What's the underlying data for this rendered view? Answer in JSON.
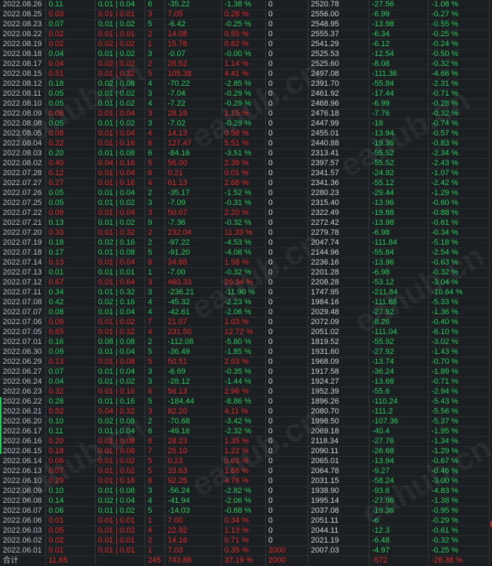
{
  "watermark": "eahub.cn",
  "columns": [
    "date",
    "v1",
    "v2",
    "v3",
    "v4",
    "v5",
    "v6",
    "v7",
    "v8",
    "v9"
  ],
  "rows": [
    [
      "2022.08.26",
      "0.11",
      "0.01 | 0.04",
      "6",
      "-35.22",
      "-1.38 %",
      "0",
      "2520.78",
      "-27.56",
      "-1.08 %"
    ],
    [
      "2022.08.25",
      "0.03",
      "0.01 | 0.01",
      "3",
      "7.05",
      "0.28 %",
      "0",
      "2556.00",
      "-6.99",
      "-0.27 %"
    ],
    [
      "2022.08.23",
      "0.07",
      "0.01 | 0.02",
      "5",
      "-6.42",
      "-0.25 %",
      "0",
      "2548.95",
      "-13.98",
      "-0.55 %"
    ],
    [
      "2022.08.22",
      "0.02",
      "0.01 | 0.01",
      "2",
      "14.08",
      "0.55 %",
      "0",
      "2555.37",
      "-6.34",
      "-0.25 %"
    ],
    [
      "2022.08.19",
      "0.02",
      "0.02 | 0.02",
      "1",
      "15.76",
      "0.62 %",
      "0",
      "2541.29",
      "-6.12",
      "-0.24 %"
    ],
    [
      "2022.08.18",
      "0.04",
      "0.01 | 0.02",
      "3",
      "-0.07",
      "-0.00 %",
      "0",
      "2525.53",
      "-12.54",
      "-0.50 %"
    ],
    [
      "2022.08.17",
      "0.04",
      "0.02 | 0.02",
      "2",
      "28.52",
      "1.14 %",
      "0",
      "2525.60",
      "-8.08",
      "-0.32 %"
    ],
    [
      "2022.08.15",
      "0.51",
      "0.01 | 0.32",
      "5",
      "105.38",
      "4.41 %",
      "0",
      "2497.08",
      "-111.36",
      "-4.66 %"
    ],
    [
      "2022.08.12",
      "0.18",
      "0.02 | 0.08",
      "4",
      "-70.22",
      "-2.85 %",
      "0",
      "2391.70",
      "-55.84",
      "-2.31 %"
    ],
    [
      "2022.08.11",
      "0.05",
      "0.01 | 0.02",
      "3",
      "-7.04",
      "-0.29 %",
      "0",
      "2461.92",
      "-17.44",
      "-0.71 %"
    ],
    [
      "2022.08.10",
      "0.05",
      "0.01 | 0.02",
      "4",
      "-7.22",
      "-0.29 %",
      "0",
      "2468.96",
      "-6.99",
      "-0.28 %"
    ],
    [
      "2022.08.09",
      "0.06",
      "0.01 | 0.04",
      "3",
      "28.19",
      "1.15 %",
      "0",
      "2476.18",
      "-7.76",
      "-0.32 %"
    ],
    [
      "2022.08.08",
      "0.05",
      "0.01 | 0.02",
      "3",
      "-7.02",
      "-0.29 %",
      "0",
      "2447.99",
      "-18",
      "-0.74 %"
    ],
    [
      "2022.08.05",
      "0.08",
      "0.01 | 0.04",
      "4",
      "14.13",
      "0.58 %",
      "0",
      "2455.01",
      "-13.94",
      "-0.57 %"
    ],
    [
      "2022.08.04",
      "0.22",
      "0.01 | 0.16",
      "6",
      "127.47",
      "5.51 %",
      "0",
      "2440.88",
      "-19.36",
      "-0.83 %"
    ],
    [
      "2022.08.03",
      "0.20",
      "0.01 | 0.08",
      "6",
      "-84.16",
      "-3.51 %",
      "0",
      "2313.41",
      "-55.52",
      "-2.34 %"
    ],
    [
      "2022.08.02",
      "0.40",
      "0.04 | 0.16",
      "5",
      "56.00",
      "2.39 %",
      "0",
      "2397.57",
      "-55.52",
      "-2.43 %"
    ],
    [
      "2022.07.28",
      "0.12",
      "0.01 | 0.04",
      "6",
      "0.21",
      "0.01 %",
      "0",
      "2341.57",
      "-24.92",
      "-1.07 %"
    ],
    [
      "2022.07.27",
      "0.27",
      "0.01 | 0.16",
      "4",
      "61.13",
      "2.68 %",
      "0",
      "2341.36",
      "-55.12",
      "-2.42 %"
    ],
    [
      "2022.07.26",
      "0.05",
      "0.01 | 0.04",
      "2",
      "-35.17",
      "-1.52 %",
      "0",
      "2280.23",
      "-29.44",
      "-1.29 %"
    ],
    [
      "2022.07.25",
      "0.05",
      "0.01 | 0.02",
      "3",
      "-7.09",
      "-0.31 %",
      "0",
      "2315.40",
      "-13.96",
      "-0.60 %"
    ],
    [
      "2022.07.22",
      "0.09",
      "0.01 | 0.04",
      "3",
      "50.07",
      "2.20 %",
      "0",
      "2322.49",
      "-19.88",
      "-0.88 %"
    ],
    [
      "2022.07.21",
      "0.13",
      "0.01 | 0.02",
      "9",
      "-7.36",
      "-0.32 %",
      "0",
      "2272.42",
      "-13.98",
      "-0.61 %"
    ],
    [
      "2022.07.20",
      "0.33",
      "0.01 | 0.32",
      "2",
      "232.04",
      "11.33 %",
      "0",
      "2279.78",
      "-6.98",
      "-0.34 %"
    ],
    [
      "2022.07.19",
      "0.18",
      "0.02 | 0.16",
      "2",
      "-97.22",
      "-4.53 %",
      "0",
      "2047.74",
      "-111.84",
      "-5.18 %"
    ],
    [
      "2022.07.18",
      "0.17",
      "0.01 | 0.08",
      "5",
      "-91.20",
      "-4.08 %",
      "0",
      "2144.96",
      "-55.84",
      "-2.54 %"
    ],
    [
      "2022.07.14",
      "0.13",
      "0.01 | 0.04",
      "8",
      "34.88",
      "1.58 %",
      "0",
      "2236.16",
      "-13.96",
      "-0.63 %"
    ],
    [
      "2022.07.13",
      "0.01",
      "0.01 | 0.01",
      "1",
      "-7.00",
      "-0.32 %",
      "0",
      "2201.28",
      "-6.98",
      "-0.32 %"
    ],
    [
      "2022.07.12",
      "0.67",
      "0.01 | 0.64",
      "3",
      "460.33",
      "26.34 %",
      "0",
      "2208.28",
      "-53.12",
      "-3.04 %"
    ],
    [
      "2022.07.11",
      "0.34",
      "0.01 | 0.32",
      "3",
      "-236.21",
      "-11.90 %",
      "0",
      "1747.95",
      "-211.84",
      "-10.64 %"
    ],
    [
      "2022.07.08",
      "0.42",
      "0.02 | 0.16",
      "4",
      "-45.32",
      "-2.23 %",
      "0",
      "1984.16",
      "-111.68",
      "-5.33 %"
    ],
    [
      "2022.07.07",
      "0.08",
      "0.01 | 0.04",
      "4",
      "-42.61",
      "-2.06 %",
      "0",
      "2029.48",
      "-27.92",
      "-1.36 %"
    ],
    [
      "2022.07.06",
      "0.09",
      "0.01 | 0.02",
      "7",
      "21.07",
      "1.03 %",
      "0",
      "2072.09",
      "-8.26",
      "-0.40 %"
    ],
    [
      "2022.07.05",
      "0.65",
      "0.01 | 0.32",
      "4",
      "231.50",
      "12.72 %",
      "0",
      "2051.02",
      "-111.04",
      "-6.10 %"
    ],
    [
      "2022.07.01",
      "0.16",
      "0.08 | 0.08",
      "2",
      "-112.08",
      "-5.80 %",
      "0",
      "1819.52",
      "-55.92",
      "-3.02 %"
    ],
    [
      "2022.06.30",
      "0.09",
      "0.01 | 0.04",
      "5",
      "-36.49",
      "-1.85 %",
      "0",
      "1931.60",
      "-27.92",
      "-1.43 %"
    ],
    [
      "2022.06.29",
      "0.13",
      "0.01 | 0.08",
      "5",
      "50.51",
      "2.63 %",
      "0",
      "1968.09",
      "-13.74",
      "-0.70 %"
    ],
    [
      "2022.06.27",
      "0.07",
      "0.01 | 0.04",
      "3",
      "-6.69",
      "-0.35 %",
      "0",
      "1917.58",
      "-36.24",
      "-1.89 %"
    ],
    [
      "2022.06.24",
      "0.04",
      "0.01 | 0.02",
      "3",
      "-28.12",
      "-1.44 %",
      "0",
      "1924.27",
      "-13.68",
      "-0.71 %"
    ],
    [
      "2022.06.23",
      "0.32",
      "0.01 | 0.16",
      "6",
      "56.13",
      "2.96 %",
      "0",
      "1952.39",
      "-55.6",
      "-2.94 %"
    ],
    [
      "2022.06.22",
      "0.28",
      "0.01 | 0.16",
      "5",
      "-184.44",
      "-8.86 %",
      "0",
      "1896.26",
      "-110.24",
      "-5.43 %"
    ],
    [
      "2022.06.21",
      "0.52",
      "0.04 | 0.32",
      "3",
      "82.20",
      "4.11 %",
      "0",
      "2080.70",
      "-111.2",
      "-5.56 %"
    ],
    [
      "2022.06.20",
      "0.10",
      "0.02 | 0.08",
      "2",
      "-70.68",
      "-3.42 %",
      "0",
      "1998.50",
      "-107.36",
      "-5.37 %"
    ],
    [
      "2022.06.17",
      "0.11",
      "0.01 | 0.04",
      "6",
      "-49.16",
      "-2.32 %",
      "0",
      "2069.18",
      "-40.4",
      "-1.95 %"
    ],
    [
      "2022.06.16",
      "0.20",
      "0.01 | 0.08",
      "8",
      "28.23",
      "1.35 %",
      "0",
      "2118.34",
      "-27.76",
      "-1.34 %"
    ],
    [
      "2022.06.15",
      "0.18",
      "0.01 | 0.08",
      "7",
      "25.10",
      "1.22 %",
      "0",
      "2090.11",
      "-26.68",
      "-1.29 %"
    ],
    [
      "2022.06.14",
      "0.06",
      "0.01 | 0.02",
      "5",
      "0.23",
      "0.01 %",
      "0",
      "2065.01",
      "-13.94",
      "-0.67 %"
    ],
    [
      "2022.06.13",
      "0.07",
      "0.01 | 0.02",
      "5",
      "33.63",
      "1.66 %",
      "0",
      "2064.78",
      "-9.27",
      "-0.46 %"
    ],
    [
      "2022.06.10",
      "0.29",
      "0.01 | 0.16",
      "8",
      "92.25",
      "4.76 %",
      "0",
      "2031.15",
      "-58.24",
      "-3.00 %"
    ],
    [
      "2022.06.09",
      "0.10",
      "0.01 | 0.08",
      "3",
      "-56.24",
      "-2.82 %",
      "0",
      "1938.90",
      "-93.6",
      "-4.83 %"
    ],
    [
      "2022.06.08",
      "0.14",
      "0.02 | 0.04",
      "4",
      "-41.94",
      "-2.06 %",
      "0",
      "1995.14",
      "-27.96",
      "-1.38 %"
    ],
    [
      "2022.06.07",
      "0.06",
      "0.01 | 0.02",
      "5",
      "-14.03",
      "-0.68 %",
      "0",
      "2037.08",
      "-19.36",
      "-0.95 %"
    ],
    [
      "2022.06.06",
      "0.01",
      "0.01 | 0.01",
      "1",
      "7.00",
      "0.34 %",
      "0",
      "2051.11",
      "-6",
      "-0.29 %"
    ],
    [
      "2022.06.03",
      "0.05",
      "0.01 | 0.02",
      "4",
      "22.92",
      "1.13 %",
      "0",
      "2044.11",
      "-12.3",
      "-0.61 %"
    ],
    [
      "2022.06.02",
      "0.02",
      "0.01 | 0.01",
      "2",
      "14.16",
      "0.71 %",
      "0",
      "2021.19",
      "-6.48",
      "-0.32 %"
    ],
    [
      "2022.06.01",
      "0.01",
      "0.01 | 0.01",
      "1",
      "7.03",
      "0.35 %",
      "2000",
      "2007.03",
      "-4.97",
      "-0.25 %"
    ]
  ],
  "total": [
    "合计",
    "11.65",
    "",
    "245",
    "743.86",
    "37.19 %",
    "2000",
    "",
    "-572",
    "-28.38 %"
  ],
  "colors": {
    "up": "#e02b2b",
    "down": "#22d05e",
    "bg": "#1c1f22",
    "date": "#b9bec4"
  }
}
